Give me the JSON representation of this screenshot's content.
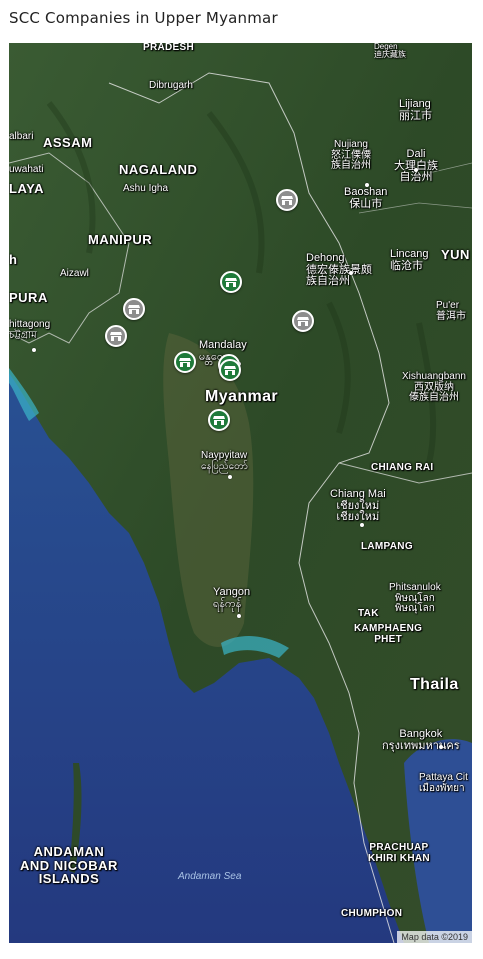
{
  "title": "SCC Companies in Upper Myanmar",
  "colors": {
    "marker_active": "#1f7a3a",
    "marker_inactive": "#8d8d8d",
    "land": "#2f4a27",
    "sea": "#2c4a8f"
  },
  "icons": {
    "marker": "store-icon"
  },
  "map": {
    "labels": {
      "pradesh": "PRADESH",
      "degen": "Degen\n迪庆藏族",
      "dibrugarh": "Dibrugarh",
      "lijiang": "Lijiang\n丽江市",
      "assam": "ASSAM",
      "nujiang": "Nujiang\n怒江傈僳\n族自治州",
      "dali": "Dali\n大理白族\n自治州",
      "guwahati": "uwahati",
      "albari": "albari",
      "nagaland": "NAGALAND",
      "ashu_igha": "Ashu Igha",
      "laya": "LAYA",
      "baoshan": "Baoshan\n保山市",
      "manipur": "MANIPUR",
      "dehong": "Dehong\n德宏傣族景颇\n族自治州",
      "lincang": "Lincang\n临沧市",
      "yun": "YUN",
      "h_edge": "h",
      "aizawl": "Aizawl",
      "pura": "PURA",
      "chittagong": "hittagong\nচট্টগ্রাম",
      "puer": "Pu'er\n普洱市",
      "mandalay": "Mandalay\nမန္တလေး",
      "myanmar": "Myanmar",
      "xishuangbanna": "Xishuangbann\n西双版纳\n傣族自治州",
      "naypyitaw": "Naypyitaw\nနေပြည်တော်",
      "chiang_rai": "CHIANG RAI",
      "chiang_mai": "Chiang Mai\nเชียงใหม่\nเชียงใหม่",
      "lampang": "LAMPANG",
      "phitsanulok": "Phitsanulok\nพิษณุโลก\nพิษณุโลก",
      "yangon": "Yangon\nရန်ကုန်",
      "tak": "TAK",
      "kamphaeng_phet": "KAMPHAENG\nPHET",
      "thailand": "Thaila",
      "bangkok": "Bangkok\nกรุงเทพมหานคร",
      "pattaya": "Pattaya Cit\nเมืองพัทยา",
      "prachuap": "PRACHUAP\nKHIRI KHAN",
      "andaman_islands": "ANDAMAN\nAND NICOBAR\nISLANDS",
      "andaman_sea": "Andaman Sea",
      "chumphon": "CHUMPHON"
    },
    "attribution": "Map data ©2019"
  },
  "markers": [
    {
      "status": "inactive"
    },
    {
      "status": "active"
    },
    {
      "status": "inactive"
    },
    {
      "status": "inactive"
    },
    {
      "status": "inactive"
    },
    {
      "status": "active"
    },
    {
      "status": "active"
    },
    {
      "status": "active"
    },
    {
      "status": "active"
    }
  ]
}
